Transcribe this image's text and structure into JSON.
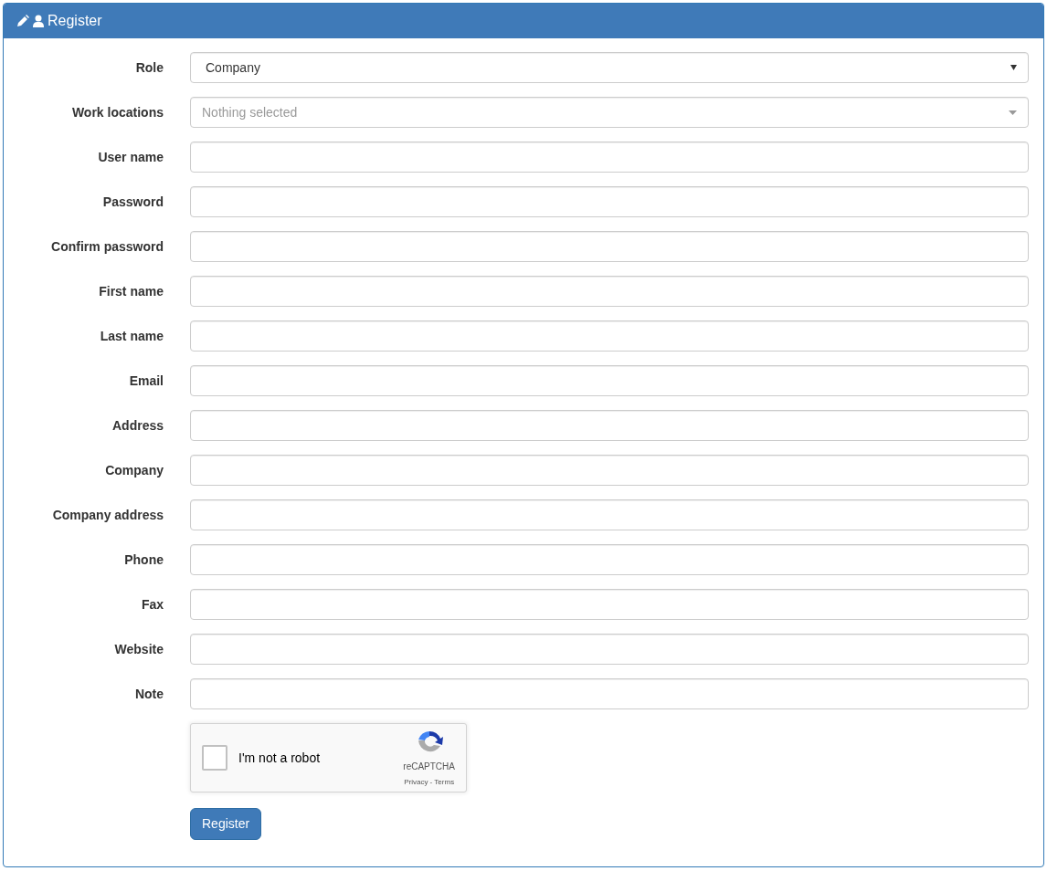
{
  "panel": {
    "title": "Register"
  },
  "fields": [
    {
      "label": "Role",
      "kind": "select",
      "value": "Company"
    },
    {
      "label": "Work locations",
      "kind": "multiselect",
      "placeholder": "Nothing selected"
    },
    {
      "label": "User name",
      "kind": "text"
    },
    {
      "label": "Password",
      "kind": "text"
    },
    {
      "label": "Confirm password",
      "kind": "text"
    },
    {
      "label": "First name",
      "kind": "text"
    },
    {
      "label": "Last name",
      "kind": "text"
    },
    {
      "label": "Email",
      "kind": "text"
    },
    {
      "label": "Address",
      "kind": "text"
    },
    {
      "label": "Company",
      "kind": "text"
    },
    {
      "label": "Company address",
      "kind": "text"
    },
    {
      "label": "Phone",
      "kind": "text"
    },
    {
      "label": "Fax",
      "kind": "text"
    },
    {
      "label": "Website",
      "kind": "text"
    },
    {
      "label": "Note",
      "kind": "text"
    }
  ],
  "captcha": {
    "label": "I'm not a robot",
    "checked": false,
    "brand": "reCAPTCHA",
    "links": "Privacy - Terms"
  },
  "submit": "Register"
}
